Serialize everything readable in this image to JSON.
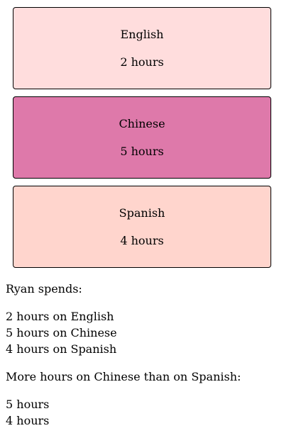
{
  "cards": [
    {
      "subject": "English",
      "hours": "2 hours",
      "color": "#ffdddd"
    },
    {
      "subject": "Chinese",
      "hours": "5 hours",
      "color": "#de79aa"
    },
    {
      "subject": "Spanish",
      "hours": "4 hours",
      "color": "#ffd5cd"
    }
  ],
  "summary": {
    "intro": "Ryan spends:",
    "lines": [
      "2 hours on English",
      "5 hours on Chinese",
      "4 hours on Spanish"
    ],
    "comparison": "More hours on Chinese than on Spanish:",
    "comparison_lines": [
      "5 hours",
      "4 hours"
    ]
  }
}
